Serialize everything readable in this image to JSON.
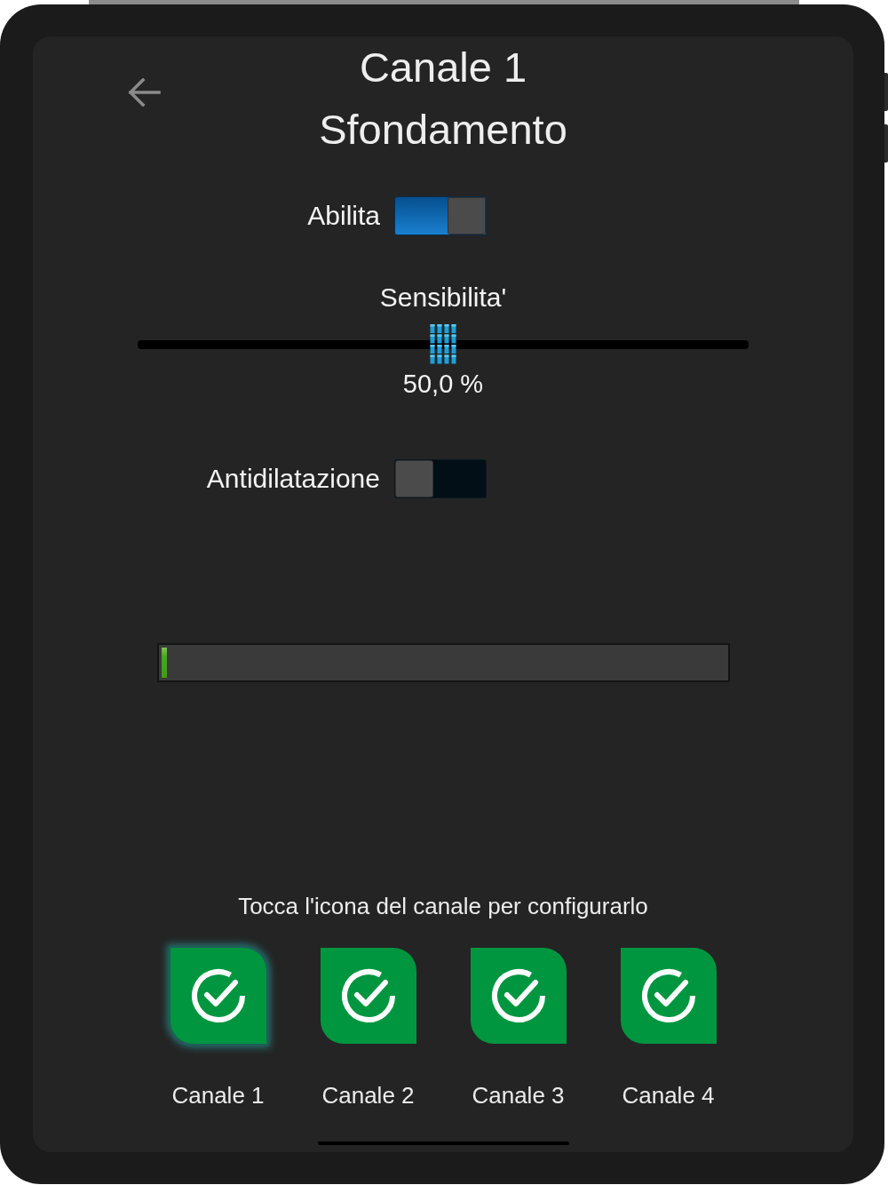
{
  "header": {
    "title": "Canale 1",
    "subtitle": "Sfondamento"
  },
  "controls": [
    {
      "kind": "switch",
      "label": "Abilita",
      "on": true
    },
    {
      "kind": "slider",
      "label": "Sensibilita'",
      "level": 0.5,
      "reading": "50,0 %"
    },
    {
      "kind": "switch",
      "label": "Antidilatazione",
      "on": false
    }
  ],
  "progress": {
    "level": 0.01
  },
  "hint": "Tocca l'icona del canale per configurarlo",
  "channels": [
    {
      "label": "Canale 1",
      "selected": true
    },
    {
      "label": "Canale 2",
      "selected": false
    },
    {
      "label": "Canale 3",
      "selected": false
    },
    {
      "label": "Canale 4",
      "selected": false
    }
  ]
}
